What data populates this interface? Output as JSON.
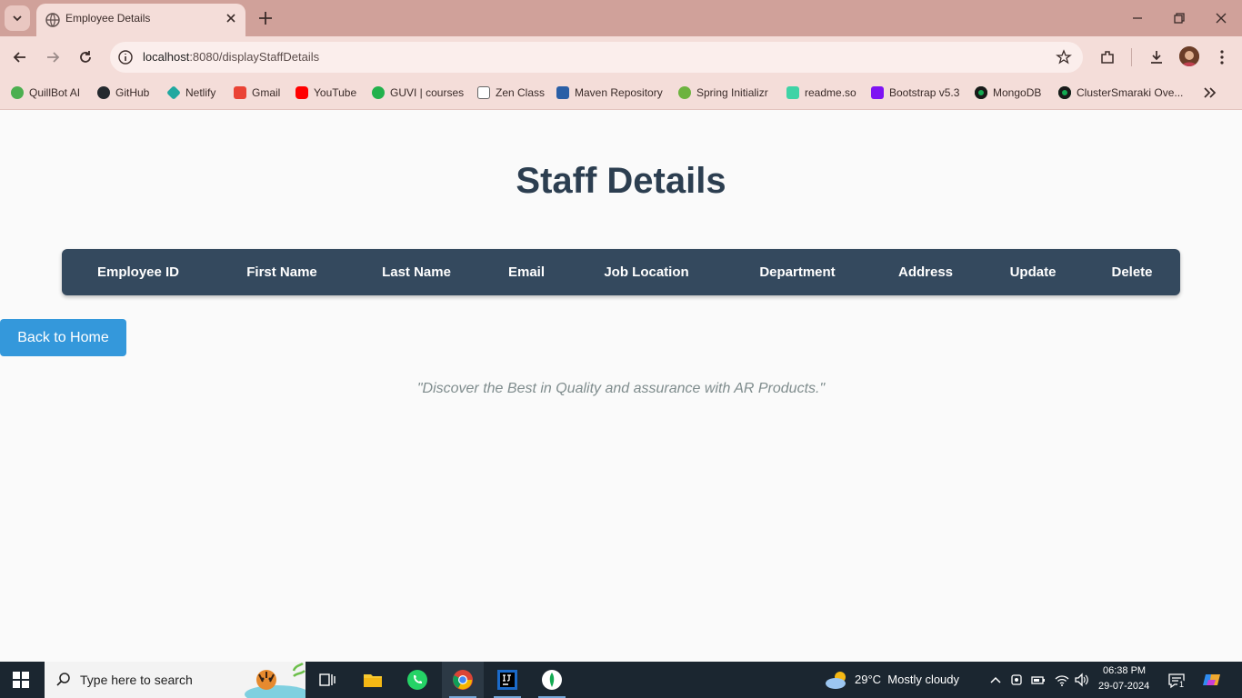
{
  "browser": {
    "tab": {
      "title": "Employee Details"
    },
    "url": {
      "host": "localhost",
      "path": ":8080/displayStaffDetails"
    },
    "bookmarks": [
      {
        "label": "QuillBot AI",
        "color": "#4caf50"
      },
      {
        "label": "GitHub",
        "color": "#24292e"
      },
      {
        "label": "Netlify",
        "color": "#20a8a0"
      },
      {
        "label": "Gmail",
        "color": "#ea4335"
      },
      {
        "label": "YouTube",
        "color": "#ff0000"
      },
      {
        "label": "GUVI | courses",
        "color": "#22b14c"
      },
      {
        "label": "Zen Class",
        "color": "#666666"
      },
      {
        "label": "Maven Repository",
        "color": "#2a5fa6"
      },
      {
        "label": "Spring Initializr",
        "color": "#6db33f"
      },
      {
        "label": "readme.so",
        "color": "#3fd3a6"
      },
      {
        "label": "Bootstrap v5.3",
        "color": "#7e13f3"
      },
      {
        "label": "MongoDB",
        "color": "#13aa52"
      },
      {
        "label": "ClusterSmaraki Ove...",
        "color": "#13aa52"
      }
    ]
  },
  "page": {
    "heading": "Staff Details",
    "table_headers": [
      "Employee ID",
      "First Name",
      "Last Name",
      "Email",
      "Job Location",
      "Department",
      "Address",
      "Update",
      "Delete"
    ],
    "back_button": "Back to Home",
    "tagline": "\"Discover the Best in Quality and assurance with AR Products.\""
  },
  "taskbar": {
    "search_placeholder": "Type here to search",
    "weather": "29°C  Mostly cloudy",
    "time": "06:38 PM",
    "date": "29-07-2024",
    "notification_count": "1"
  }
}
